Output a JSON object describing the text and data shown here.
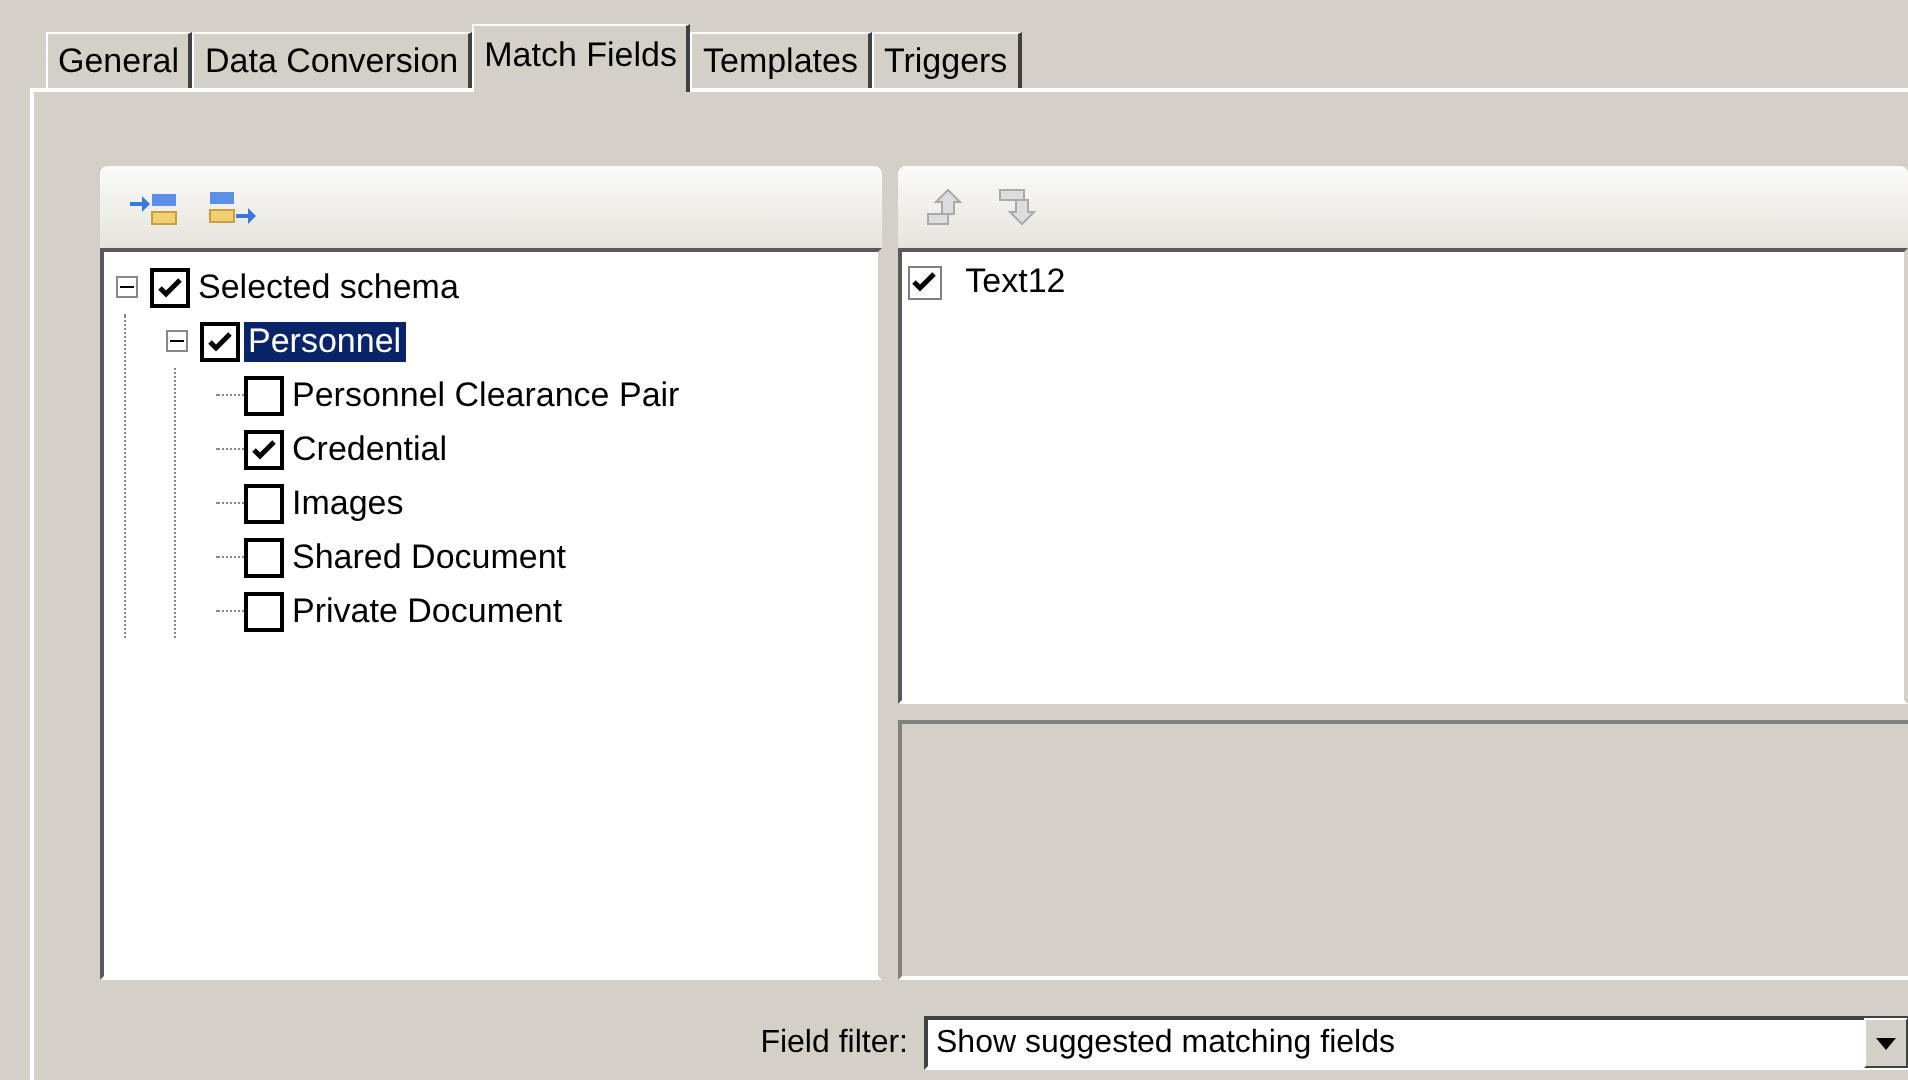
{
  "tabs": [
    {
      "label": "General",
      "selected": false
    },
    {
      "label": "Data Conversion",
      "selected": false
    },
    {
      "label": "Match Fields",
      "selected": true
    },
    {
      "label": "Templates",
      "selected": false
    },
    {
      "label": "Triggers",
      "selected": false
    }
  ],
  "schema_tree": {
    "items": [
      {
        "label": "Selected schema",
        "checked": true,
        "selected": false,
        "expanded": true,
        "children": [
          {
            "label": "Personnel",
            "checked": true,
            "selected": true,
            "expanded": true,
            "children": [
              {
                "label": "Personnel Clearance Pair",
                "checked": false,
                "selected": false
              },
              {
                "label": "Credential",
                "checked": true,
                "selected": false
              },
              {
                "label": "Images",
                "checked": false,
                "selected": false
              },
              {
                "label": "Shared Document",
                "checked": false,
                "selected": false
              },
              {
                "label": "Private Document",
                "checked": false,
                "selected": false
              }
            ]
          }
        ]
      }
    ]
  },
  "fields_list": {
    "items": [
      {
        "label": "Text12",
        "checked": true
      }
    ]
  },
  "field_filter": {
    "label": "Field filter:",
    "value": "Show suggested matching fields"
  }
}
